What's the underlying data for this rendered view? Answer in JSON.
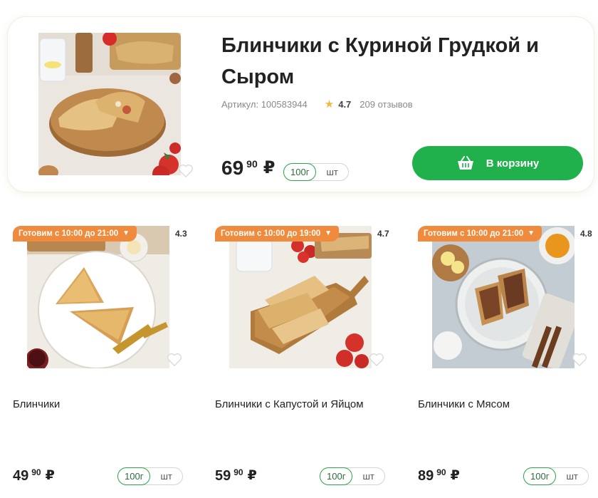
{
  "featured": {
    "title": "Блинчики с Куриной Грудкой и Сыром",
    "article": "Артикул: 100583944",
    "rating": "4.7",
    "reviews": "209 отзывов",
    "price_main": "69",
    "price_cents": "90",
    "currency": "₽",
    "unit_active": "100г",
    "unit_inactive": "шт",
    "cart_label": "В корзину"
  },
  "products": [
    {
      "badge": "Готовим с 10:00 до 21:00",
      "rating": "4.3",
      "name": "Блинчики",
      "price_main": "49",
      "price_cents": "90",
      "currency": "₽",
      "unit_active": "100г",
      "unit_inactive": "шт"
    },
    {
      "badge": "Готовим с 10:00 до 19:00",
      "rating": "4.7",
      "name": "Блинчики с Капустой и Яйцом",
      "price_main": "59",
      "price_cents": "90",
      "currency": "₽",
      "unit_active": "100г",
      "unit_inactive": "шт"
    },
    {
      "badge": "Готовим с 10:00 до 21:00",
      "rating": "4.8",
      "name": "Блинчики с Мясом",
      "price_main": "89",
      "price_cents": "90",
      "currency": "₽",
      "unit_active": "100г",
      "unit_inactive": "шт"
    }
  ],
  "colors": {
    "accent_green": "#20b14d",
    "badge_orange": "#f08a3c",
    "star": "#f1b941"
  },
  "icons": [
    "basket-icon",
    "star-icon",
    "heart-icon",
    "chevron-down-icon"
  ]
}
